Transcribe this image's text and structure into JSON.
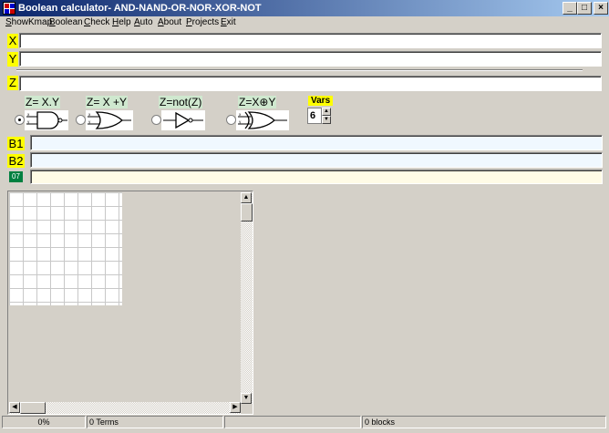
{
  "window": {
    "title": "Boolean calculator- AND-NAND-OR-NOR-XOR-NOT",
    "min_glyph": "_",
    "max_glyph": "□",
    "close_glyph": "×"
  },
  "menu": [
    "ShowKmap",
    "Boolean",
    "Check",
    "Help",
    "Auto",
    "About",
    "Projects",
    "Exit"
  ],
  "fields": {
    "x_label": "X",
    "x_value": "",
    "y_label": "Y",
    "y_value": "",
    "z_label": "Z",
    "z_value": "",
    "b1_label": "B1",
    "b1_value": "",
    "b2_label": "B2",
    "b2_value": "",
    "b3_label": "07",
    "b3_value": ""
  },
  "gates": [
    {
      "label": "Z= X.Y",
      "icon": "and-gate-icon",
      "selected": true
    },
    {
      "label": "Z= X +Y",
      "icon": "or-gate-icon",
      "selected": false
    },
    {
      "label": "Z=not(Z)",
      "icon": "not-gate-icon",
      "selected": false
    },
    {
      "label": "Z=X⊕Y",
      "icon": "xor-gate-icon",
      "selected": false
    }
  ],
  "vars": {
    "label": "Vars",
    "value": "6"
  },
  "status": {
    "progress": "0%",
    "terms": "0 Terms",
    "blocks": "0 blocks"
  },
  "colors": {
    "label_bg": "#ffff00",
    "b3_label_bg": "#008040",
    "titlebar": "#0a246a"
  }
}
